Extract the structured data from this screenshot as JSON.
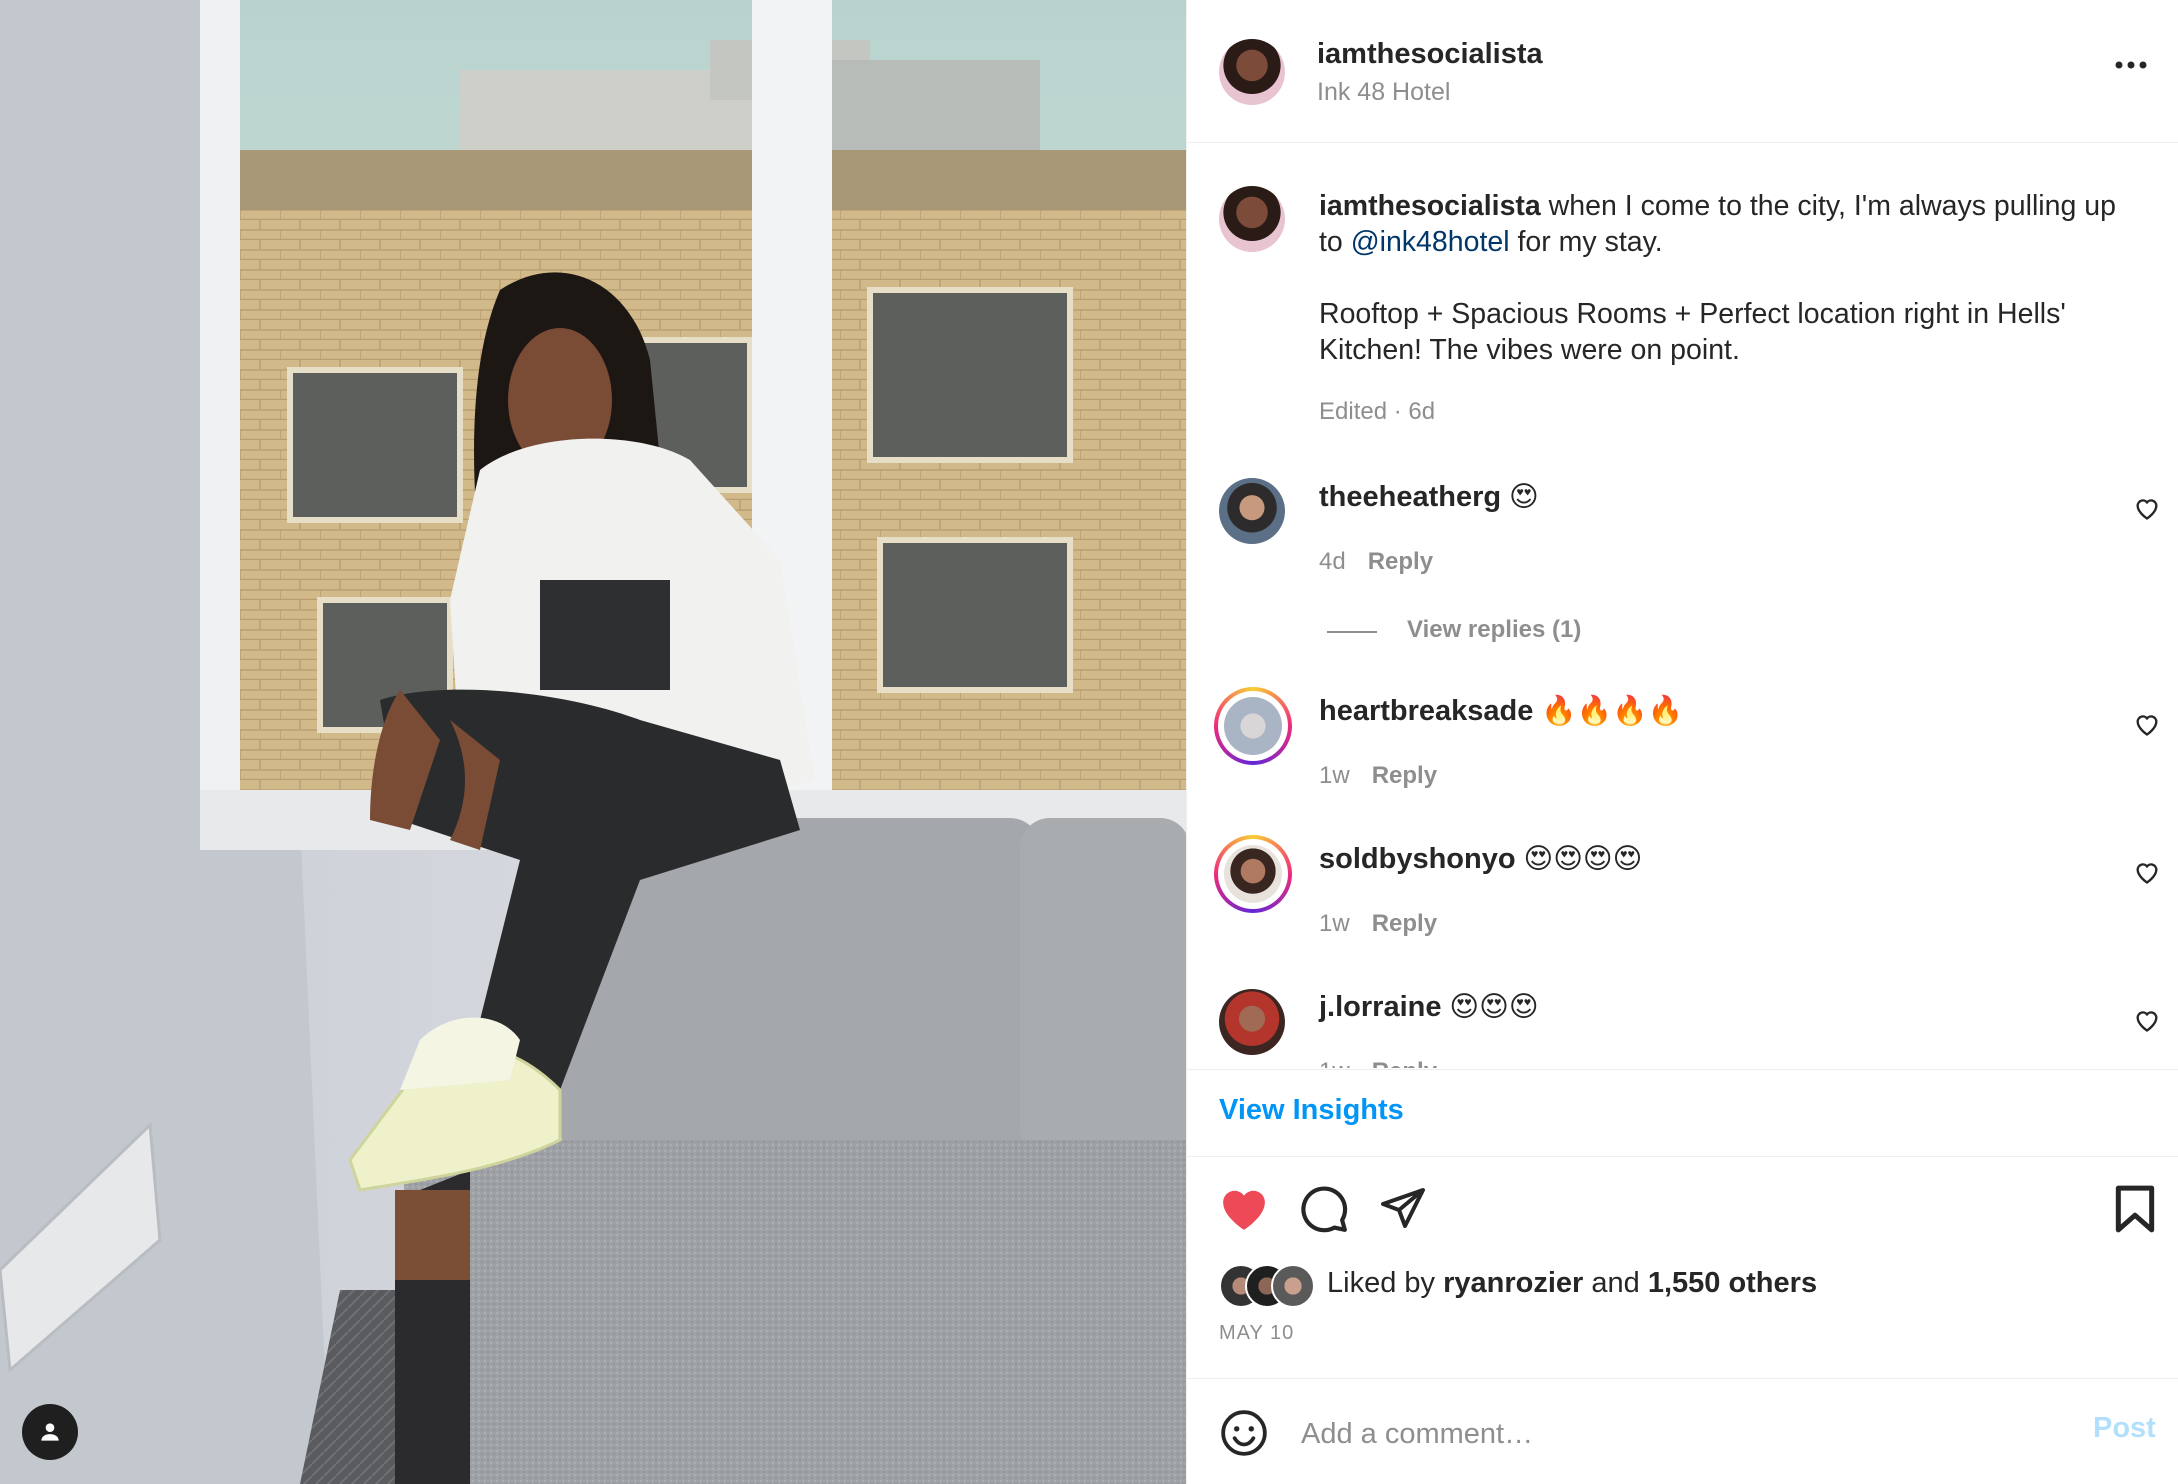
{
  "post": {
    "photo_alt": "",
    "author": {
      "username": "iamthesocialista",
      "location": "Ink 48 Hotel"
    },
    "caption": {
      "username": "iamthesocialista",
      "line1_before": " when I come to the city, I'm always pulling up to ",
      "mention": "@ink48hotel",
      "line1_after": " for my stay.",
      "paragraph2": "Rooftop + Spacious Rooms + Perfect location right in Hells' Kitchen! The vibes were on point.",
      "meta": "Edited · 6d"
    },
    "comments": [
      {
        "username": "theeheatherg",
        "text": "😍",
        "time": "4d",
        "reply": "Reply",
        "view_replies": "View replies (1)"
      },
      {
        "username": "heartbreaksade",
        "text": "🔥🔥🔥🔥",
        "time": "1w",
        "reply": "Reply"
      },
      {
        "username": "soldbyshonyo",
        "text": "😍😍😍😍",
        "time": "1w",
        "reply": "Reply"
      },
      {
        "username": "j.lorraine",
        "text": "😍😍😍",
        "time": "1w",
        "reply": "Reply"
      }
    ],
    "view_insights": "View Insights",
    "likes": {
      "prefix": "Liked by ",
      "user": "ryanrozier",
      "middle": " and ",
      "others": "1,550 others"
    },
    "date": "MAY 10",
    "add_comment": {
      "placeholder": "Add a comment…",
      "post_label": "Post"
    }
  },
  "colors": {
    "accent": "#0095f6",
    "like_red": "#ed4956",
    "mention": "#00376b",
    "muted": "#8e8e8e"
  },
  "icons": [
    "more-options-icon",
    "heart-icon",
    "comment-icon",
    "share-icon",
    "bookmark-icon",
    "emoji-icon",
    "user-tag-icon"
  ]
}
